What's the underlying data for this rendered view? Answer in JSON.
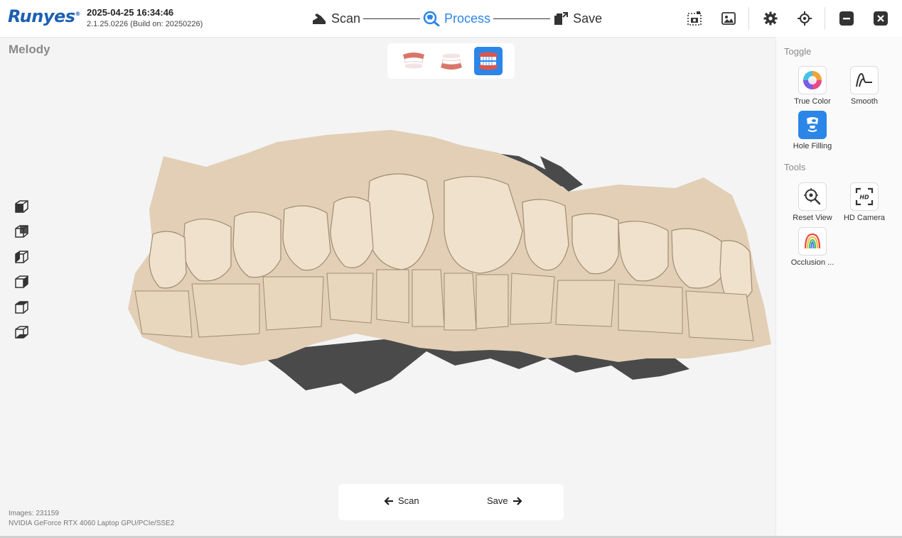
{
  "app": {
    "brand": "Runyes",
    "brand_mark": "®",
    "datetime": "2025-04-25 16:34:46",
    "version": "2.1.25.0226 (Build on: 20250226)"
  },
  "workflow": {
    "steps": [
      {
        "label": "Scan",
        "icon": "scanner-icon",
        "active": false
      },
      {
        "label": "Process",
        "icon": "process-tooth-icon",
        "active": true
      },
      {
        "label": "Save",
        "icon": "save-export-icon",
        "active": false
      }
    ]
  },
  "top_icons": [
    "screenshot-icon",
    "image-gallery-icon",
    "settings-gear-icon",
    "crosshair-target-icon",
    "minimize-icon",
    "close-icon"
  ],
  "patient": {
    "name": "Melody"
  },
  "jaw_selector": {
    "options": [
      "upper-jaw",
      "lower-jaw",
      "both-jaws"
    ],
    "selected": "both-jaws"
  },
  "view_cubes": [
    "view-front-cube-icon",
    "view-back-cube-icon",
    "view-left-cube-icon",
    "view-right-cube-icon",
    "view-top-cube-icon",
    "view-bottom-cube-icon"
  ],
  "panel": {
    "toggle_label": "Toggle",
    "toggle_items": [
      {
        "label": "True Color",
        "icon": "color-wheel-icon",
        "active": false
      },
      {
        "label": "Smooth",
        "icon": "smooth-curve-icon",
        "active": false
      },
      {
        "label": "Hole Filling",
        "icon": "hole-filling-icon",
        "active": true
      }
    ],
    "tools_label": "Tools",
    "tool_items": [
      {
        "label": "Reset View",
        "icon": "reset-view-icon"
      },
      {
        "label": "HD Camera",
        "icon": "hd-camera-icon"
      },
      {
        "label": "Occlusion ...",
        "icon": "occlusion-arch-icon"
      }
    ]
  },
  "bottom_nav": {
    "back_label": "Scan",
    "next_label": "Save"
  },
  "status": {
    "images": "Images: 231159",
    "gpu": "NVIDIA GeForce RTX 4060 Laptop GPU/PCIe/SSE2"
  },
  "colors": {
    "accent": "#2b86e8",
    "brand": "#1d5fb3",
    "model_tooth": "#e0cdb4",
    "model_gum_dark": "#4a4a4a"
  }
}
